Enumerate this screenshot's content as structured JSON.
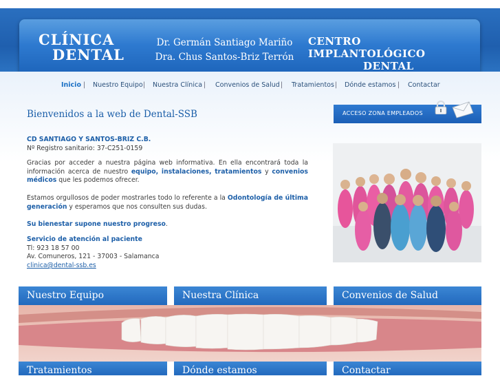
{
  "header": {
    "logo_left_line1": "CLÍNICA",
    "logo_left_line2": "DENTAL",
    "doctor1": "Dr. Germán Santiago Mariño",
    "doctor2": "Dra. Chus Santos-Briz Terrón",
    "logo_right_line1": "CENTRO IMPLANTOLÓGICO",
    "logo_right_line2": "DENTAL"
  },
  "nav": {
    "items": [
      "Inicio",
      "Nuestro Equipo",
      "Nuestra Clínica",
      "Convenios de Salud",
      "Tratamientos",
      "Dónde estamos",
      "Contactar"
    ],
    "separator": "|"
  },
  "main": {
    "welcome": "Bienvenidos a la web de Dental-SSB",
    "company": "CD SANTIAGO Y SANTOS-BRIZ C.B.",
    "registro": "Nº Registro sanitario: 37-C251-0159",
    "intro_a": "Gracias por acceder a nuestra página web informativa. En ella encontrará toda la información acerca de nuestro ",
    "intro_link1": "equipo,",
    "intro_link2": "instalaciones,",
    "intro_link3": "tratamientos",
    "intro_y": " y ",
    "intro_link4": "convenios médicos",
    "intro_b": " que les podemos ofrecer.",
    "pride_a": "Estamos orgullosos de poder mostrarles todo lo referente a la ",
    "pride_link": "Odontología de última generación",
    "pride_b": " y esperamos que nos consulten sus dudas.",
    "tagline": "Su bienestar supone nuestro progreso",
    "tagline_end": ".",
    "service_title": "Servicio de atención al paciente",
    "phone": "Tl: 923 18 57 00",
    "address": "Av. Comuneros, 121 - 37003 - Salamanca",
    "email": "clinica@dental-ssb.es"
  },
  "sidebar": {
    "access_label": "ACCESO ZONA EMPLEADOS"
  },
  "tiles": {
    "t1": "Nuestro Equipo",
    "t2": "Nuestra Clínica",
    "t3": "Convenios de Salud",
    "t4": "Tratamientos",
    "t5": "Dónde estamos",
    "t6": "Contactar"
  }
}
